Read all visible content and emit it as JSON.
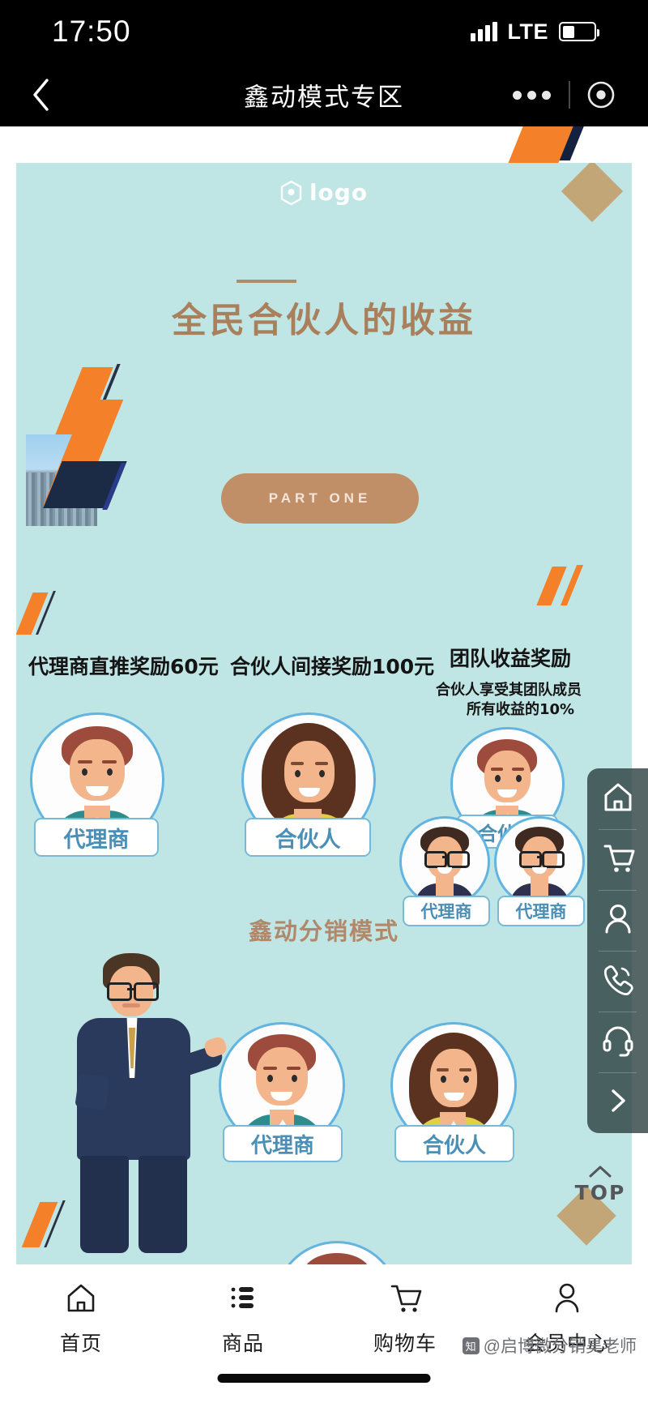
{
  "status_bar": {
    "time": "17:50",
    "network": "LTE",
    "signal_icon": "signal-bars-icon",
    "battery_icon": "battery-icon",
    "battery_level_pct": 40
  },
  "nav_bar": {
    "back_icon": "chevron-left-icon",
    "title": "鑫动模式专区",
    "more_icon": "more-dots-icon",
    "capsule_target_icon": "target-circle-icon"
  },
  "poster": {
    "logo_text": "logo",
    "logo_icon": "hexagon-location-logo-icon",
    "hero_title": "全民合伙人的收益",
    "part_button_label": "PART ONE",
    "bg_color": "#bfe5e4",
    "accent_orange": "#f4812a",
    "accent_navy": "#14223f",
    "accent_gold": "#c2a678",
    "title_color": "#a9805b",
    "columns": [
      {
        "heading": "代理商直推奖励60元",
        "sub": "",
        "badges": [
          "代理商"
        ]
      },
      {
        "heading": "合伙人间接奖励100元",
        "sub": "",
        "badges": [
          "合伙人"
        ]
      },
      {
        "heading": "团队收益奖励",
        "sub_line1": "合伙人享受其团队成员",
        "sub_line2": "所有收益的10%",
        "badges": [
          "合伙人",
          "代理商",
          "代理商"
        ]
      }
    ],
    "section2_title": "鑫动分销模式",
    "section2_badges": [
      "代理商",
      "合伙人"
    ]
  },
  "side_toolbar": {
    "items": [
      {
        "icon": "home-icon",
        "name": "home"
      },
      {
        "icon": "cart-icon",
        "name": "cart"
      },
      {
        "icon": "person-icon",
        "name": "profile"
      },
      {
        "icon": "phone-icon",
        "name": "call"
      },
      {
        "icon": "headset-support-icon",
        "name": "support"
      },
      {
        "icon": "chevron-right-icon",
        "name": "collapse"
      }
    ]
  },
  "back_to_top": {
    "label": "TOP",
    "icon": "chevron-up-icon"
  },
  "tab_bar": {
    "tabs": [
      {
        "label": "首页",
        "icon": "home-icon"
      },
      {
        "label": "商品",
        "icon": "list-icon"
      },
      {
        "label": "购物车",
        "icon": "cart-icon"
      },
      {
        "label": "会员中心",
        "icon": "person-icon"
      }
    ]
  },
  "watermark": {
    "badge": "知",
    "text": "@启博微分销昊老师"
  }
}
